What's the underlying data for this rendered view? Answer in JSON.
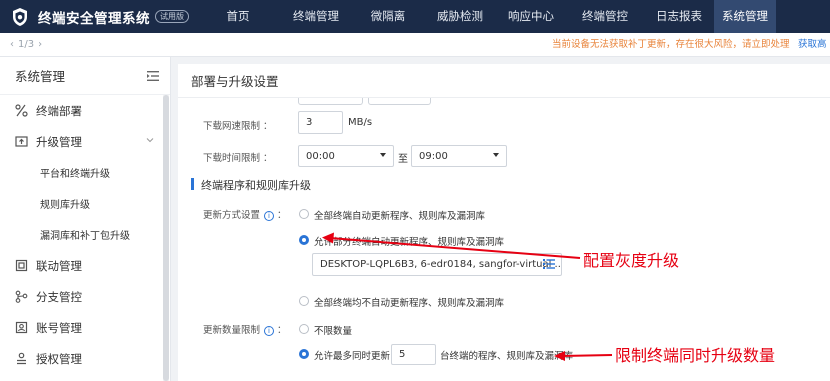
{
  "app": {
    "title": "终端安全管理系统",
    "badge": "试用版"
  },
  "nav": {
    "items": [
      "首页",
      "终端管理",
      "微隔离",
      "威胁检测",
      "响应中心",
      "终端管控",
      "日志报表",
      "系统管理"
    ],
    "active": "系统管理"
  },
  "subbar": {
    "pager": "1/3",
    "warning": "当前设备无法获取补丁更新，存在很大风险，请立即处理",
    "warning_link": "获取高"
  },
  "sidebar": {
    "title": "系统管理",
    "items": [
      {
        "label": "终端部署",
        "icon": "deploy-icon"
      },
      {
        "label": "升级管理",
        "icon": "upgrade-icon"
      },
      {
        "label": "平台和终端升级",
        "sub": true
      },
      {
        "label": "规则库升级",
        "sub": true
      },
      {
        "label": "漏洞库和补丁包升级",
        "sub": true
      },
      {
        "label": "联动管理",
        "icon": "link-icon"
      },
      {
        "label": "分支管控",
        "icon": "branch-icon"
      },
      {
        "label": "账号管理",
        "icon": "account-icon"
      },
      {
        "label": "授权管理",
        "icon": "license-icon"
      }
    ]
  },
  "main": {
    "title": "部署与升级设置",
    "download_speed": {
      "label": "下载网速限制 ：",
      "value": "3",
      "unit": "MB/s"
    },
    "download_time": {
      "label": "下载时间限制 ：",
      "from": "00:00",
      "to_text": "至",
      "to": "09:00"
    },
    "section": "终端程序和规则库升级",
    "update_mode": {
      "label": "更新方式设置",
      "options": [
        "全部终端自动更新程序、规则库及漏洞库",
        "允许部分终端自动更新程序、规则库及漏洞库",
        "全部终端均不自动更新程序、规则库及漏洞库"
      ],
      "selected": 1,
      "devices": "DESKTOP-LQPL6B3, 6-edr0184, sangfor-virtual ..."
    },
    "update_count": {
      "label": "更新数量限制",
      "options": [
        "不限数量",
        "允许最多同时更新"
      ],
      "selected": 1,
      "value": "5",
      "suffix": "台终端的程序、规则库及漏洞库"
    }
  },
  "annotations": {
    "gray_upgrade": "配置灰度升级",
    "limit_upgrade": "限制终端同时升级数量",
    "color": "#e60012"
  }
}
